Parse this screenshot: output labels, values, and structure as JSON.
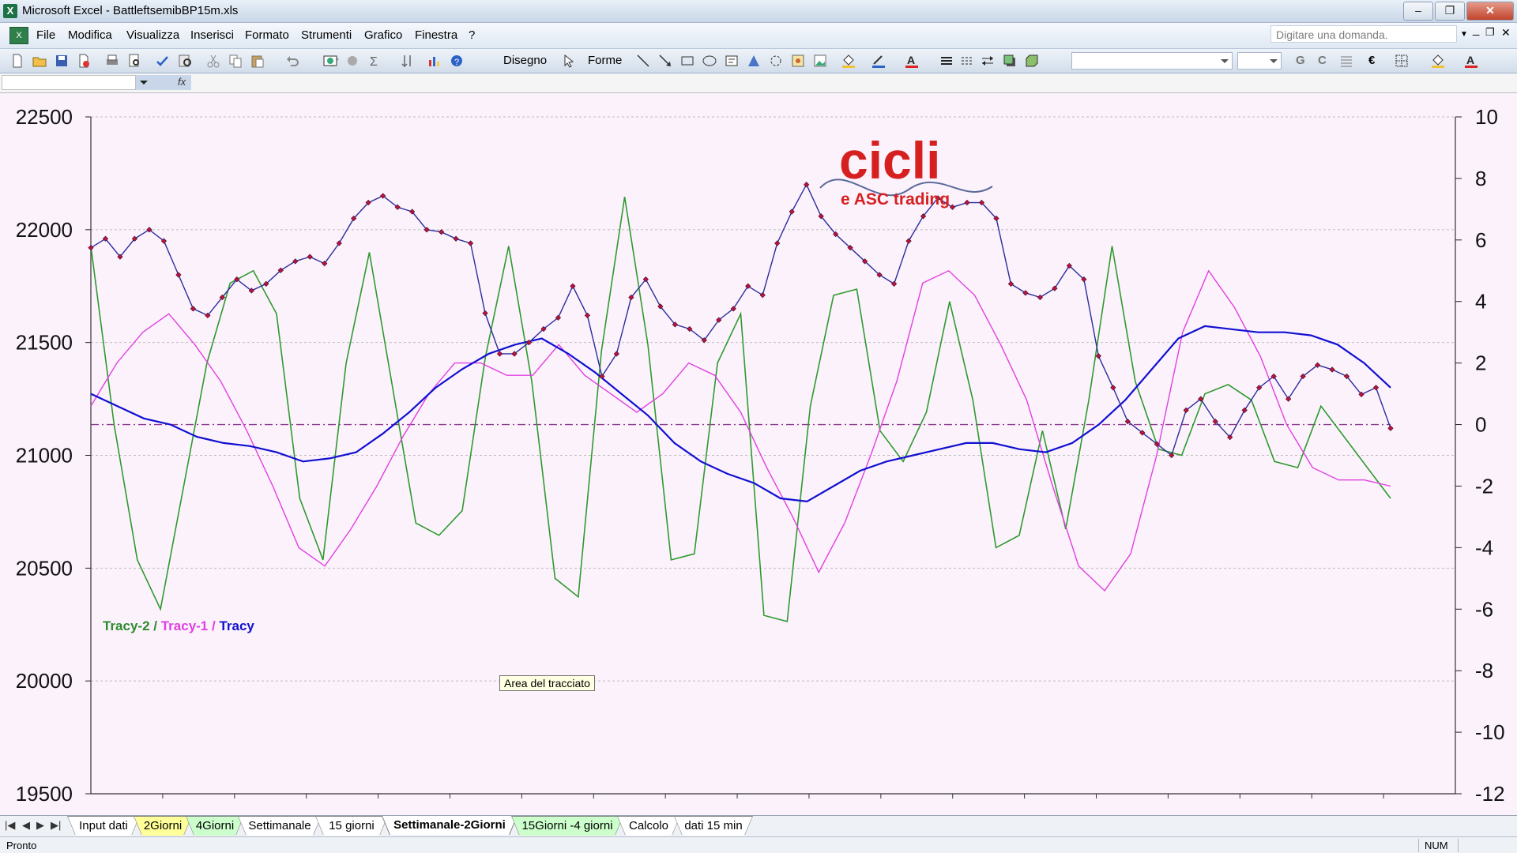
{
  "window": {
    "title": "Microsoft Excel - BattleftsemibBP15m.xls",
    "icon": "excel-icon",
    "buttons": {
      "minimize": "–",
      "restore": "❐",
      "close": "✕"
    }
  },
  "menubar": {
    "items": [
      "File",
      "Modifica",
      "Visualizza",
      "Inserisci",
      "Formato",
      "Strumenti",
      "Grafico",
      "Finestra",
      "?"
    ],
    "ask_placeholder": "Digitare una domanda.",
    "mdi_minimize": "_",
    "mdi_restore": "❐",
    "mdi_close": "✕"
  },
  "toolbar": {
    "drawing_label": "Disegno",
    "shapes_label": "Forme",
    "bold_label": "G",
    "italic_label": "C",
    "euro_label": "€"
  },
  "formulabar": {
    "fx_label": "fx"
  },
  "chart": {
    "logo_text": "cicli",
    "logo_subtext": "e ASC trading",
    "tooltip": "Area del tracciato",
    "legend": {
      "tracy2": "Tracy-2",
      "sep1": " / ",
      "tracy1": "Tracy-1",
      "sep2": " / ",
      "tracy": "Tracy"
    },
    "colors": {
      "price": "#2c2c9c",
      "price_marker": "#c0103c",
      "tracy": "#1010d0",
      "tracy1": "#e040e0",
      "tracy2": "#2e9a2e",
      "zero_line": "#8a3a8a",
      "background": "#fcf2fc"
    }
  },
  "chart_data": {
    "type": "line",
    "left_axis": {
      "ticks": [
        "22500",
        "22000",
        "21500",
        "21000",
        "20500",
        "20000",
        "19500"
      ],
      "ylim": [
        19500,
        22500
      ]
    },
    "right_axis": {
      "ticks": [
        "10",
        "8",
        "6",
        "4",
        "2",
        "0",
        "-2",
        "-4",
        "-6",
        "-8",
        "-10",
        "-12"
      ],
      "ylim": [
        -12,
        10
      ]
    },
    "grid": "horizontal dashed",
    "x_count": 90,
    "series": [
      {
        "name": "",
        "axis": "left",
        "marker": "diamond",
        "values": [
          21920,
          21960,
          21880,
          21960,
          22000,
          21950,
          21800,
          21650,
          21620,
          21700,
          21780,
          21730,
          21760,
          21820,
          21860,
          21880,
          21850,
          21940,
          22050,
          22120,
          22150,
          22100,
          22080,
          22000,
          21990,
          21960,
          21940,
          21630,
          21450,
          21450,
          21500,
          21560,
          21610,
          21750,
          21620,
          21350,
          21450,
          21700,
          21780,
          21660,
          21580,
          21560,
          21510,
          21600,
          21650,
          21750,
          21710,
          21940,
          22080,
          22200,
          22060,
          21980,
          21920,
          21860,
          21800,
          21760,
          21950,
          22060,
          22140,
          22100,
          22120,
          22120,
          22050,
          21760,
          21720,
          21700,
          21740,
          21840,
          21780,
          21440,
          21300,
          21150,
          21100,
          21050,
          21000,
          21200,
          21250,
          21150,
          21080,
          21200,
          21300,
          21350,
          21250,
          21350,
          21400,
          21380,
          21350,
          21270,
          21300,
          21120
        ]
      },
      {
        "name": "Tracy",
        "axis": "right",
        "values": [
          1.0,
          0.6,
          0.2,
          0.0,
          -0.4,
          -0.6,
          -0.7,
          -0.9,
          -1.2,
          -1.1,
          -0.9,
          -0.3,
          0.4,
          1.2,
          1.8,
          2.3,
          2.6,
          2.8,
          2.3,
          1.7,
          1.0,
          0.3,
          -0.6,
          -1.2,
          -1.6,
          -1.9,
          -2.4,
          -2.5,
          -2.0,
          -1.5,
          -1.2,
          -1.0,
          -0.8,
          -0.6,
          -0.6,
          -0.8,
          -0.9,
          -0.6,
          0.0,
          0.8,
          1.8,
          2.8,
          3.2,
          3.1,
          3.0,
          3.0,
          2.9,
          2.6,
          2.0,
          1.2
        ]
      },
      {
        "name": "Tracy-1",
        "axis": "right",
        "values": [
          0.6,
          2.0,
          3.0,
          3.6,
          2.6,
          1.4,
          -0.2,
          -2.0,
          -4.0,
          -4.6,
          -3.4,
          -2.0,
          -0.4,
          1.0,
          2.0,
          2.0,
          1.6,
          1.6,
          2.6,
          1.6,
          1.0,
          0.4,
          1.0,
          2.0,
          1.6,
          0.4,
          -1.4,
          -3.0,
          -4.8,
          -3.2,
          -1.0,
          1.4,
          4.6,
          5.0,
          4.2,
          2.6,
          0.8,
          -2.0,
          -4.6,
          -5.4,
          -4.2,
          -1.0,
          3.0,
          5.0,
          3.8,
          2.2,
          0.0,
          -1.4,
          -1.8,
          -1.8,
          -2.0
        ]
      },
      {
        "name": "Tracy-2",
        "axis": "right",
        "values": [
          5.8,
          0.0,
          -4.4,
          -6.0,
          -2.0,
          2.0,
          4.6,
          5.0,
          3.6,
          -2.4,
          -4.4,
          2.0,
          5.6,
          1.2,
          -3.2,
          -3.6,
          -2.8,
          2.2,
          5.8,
          1.4,
          -5.0,
          -5.6,
          2.4,
          7.4,
          2.6,
          -4.4,
          -4.2,
          2.0,
          3.6,
          -6.2,
          -6.4,
          0.6,
          4.2,
          4.4,
          -0.2,
          -1.2,
          0.4,
          4.0,
          0.8,
          -4.0,
          -3.6,
          -0.2,
          -3.4,
          0.8,
          5.8,
          1.4,
          -0.8,
          -1.0,
          1.0,
          1.3,
          0.8,
          -1.2,
          -1.4,
          0.6,
          -0.4,
          -1.4,
          -2.4
        ]
      }
    ]
  },
  "sheet_tabs": [
    {
      "label": "Input dati",
      "style": "plain"
    },
    {
      "label": "2Giorni",
      "style": "yellow"
    },
    {
      "label": "4Giorni",
      "style": "green"
    },
    {
      "label": "Settimanale",
      "style": "plain"
    },
    {
      "label": "15 giorni",
      "style": "plain"
    },
    {
      "label": "Settimanale-2Giorni",
      "style": "active"
    },
    {
      "label": "15Giorni -4 giorni",
      "style": "green"
    },
    {
      "label": "Calcolo",
      "style": "plain"
    },
    {
      "label": "dati 15 min",
      "style": "plain"
    }
  ],
  "statusbar": {
    "status": "Pronto",
    "num": "NUM"
  }
}
